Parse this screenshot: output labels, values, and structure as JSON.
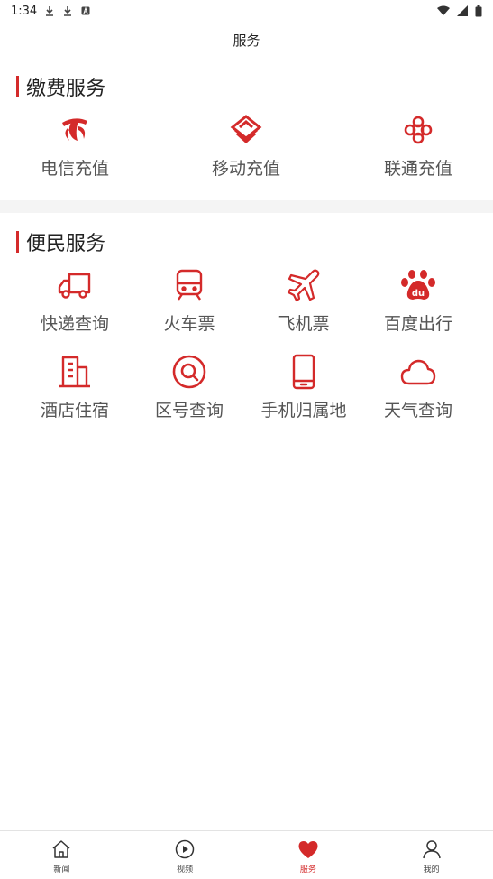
{
  "status_bar": {
    "time": "1:34"
  },
  "header": {
    "title": "服务"
  },
  "payment_section": {
    "title": "缴费服务",
    "items": [
      {
        "label": "电信充值",
        "icon": "china-telecom-icon"
      },
      {
        "label": "移动充值",
        "icon": "china-mobile-icon"
      },
      {
        "label": "联通充值",
        "icon": "china-unicom-icon"
      }
    ]
  },
  "convenience_section": {
    "title": "便民服务",
    "items": [
      {
        "label": "快递查询",
        "icon": "truck-icon"
      },
      {
        "label": "火车票",
        "icon": "train-icon"
      },
      {
        "label": "飞机票",
        "icon": "airplane-icon"
      },
      {
        "label": "百度出行",
        "icon": "baidu-paw-icon"
      },
      {
        "label": "酒店住宿",
        "icon": "building-icon"
      },
      {
        "label": "区号查询",
        "icon": "magnifier-icon"
      },
      {
        "label": "手机归属地",
        "icon": "mobile-phone-icon"
      },
      {
        "label": "天气查询",
        "icon": "cloud-icon"
      }
    ]
  },
  "bottom_nav": {
    "items": [
      {
        "label": "新闻",
        "icon": "home-icon"
      },
      {
        "label": "视频",
        "icon": "play-icon"
      },
      {
        "label": "服务",
        "icon": "heart-icon"
      },
      {
        "label": "我的",
        "icon": "user-icon"
      }
    ],
    "active": "服务"
  },
  "colors": {
    "accent": "#d42a2a",
    "divider": "#f4f4f4"
  }
}
